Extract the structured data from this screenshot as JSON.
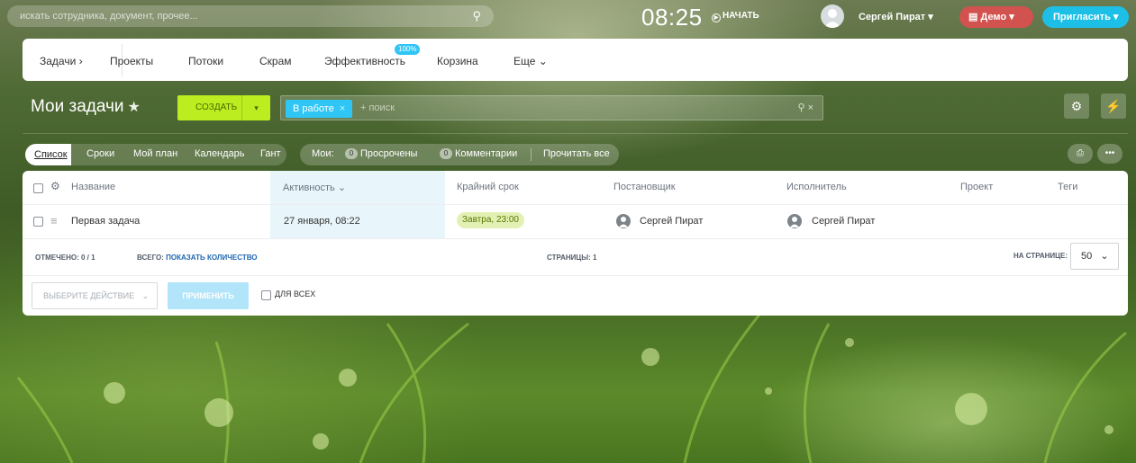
{
  "topbar": {
    "search_placeholder": "искать сотрудника, документ, прочее...",
    "clock": "08:25",
    "start_label": "НАЧАТЬ",
    "user_name": "Сергей Пират",
    "demo_label": "Демо",
    "invite_label": "Пригласить"
  },
  "nav": {
    "items": [
      "Задачи",
      "Проекты",
      "Потоки",
      "Скрам",
      "Эффективность",
      "Корзина",
      "Еще"
    ],
    "efficiency_badge": "100%"
  },
  "header": {
    "title": "Мои задачи",
    "create_label": "СОЗДАТЬ",
    "filter_chip": "В работе",
    "filter_placeholder": "+ поиск"
  },
  "views": {
    "items": [
      "Список",
      "Сроки",
      "Мой план",
      "Календарь",
      "Гант"
    ],
    "active": "Список"
  },
  "counters": {
    "label": "Мои:",
    "overdue_count": "0",
    "overdue_label": "Просрочены",
    "comments_count": "0",
    "comments_label": "Комментарии",
    "read_all": "Прочитать все"
  },
  "table": {
    "columns": [
      "Название",
      "Активность",
      "Крайний срок",
      "Постановщик",
      "Исполнитель",
      "Проект",
      "Теги"
    ],
    "rows": [
      {
        "title": "Первая задача",
        "activity": "27 января, 08:22",
        "deadline": "Завтра, 23:00",
        "creator": "Сергей Пират",
        "responsible": "Сергей Пират",
        "project": "",
        "tags": ""
      }
    ]
  },
  "footer": {
    "marked_label": "ОТМЕЧЕНО:",
    "marked_value": "0 / 1",
    "total_label": "ВСЕГО:",
    "total_link": "ПОКАЗАТЬ КОЛИЧЕСТВО",
    "pages_label": "СТРАНИЦЫ:",
    "pages_value": "1",
    "per_page_label": "НА СТРАНИЦЕ:",
    "per_page_value": "50",
    "action_placeholder": "ВЫБЕРИТЕ ДЕЙСТВИЕ",
    "apply_label": "ПРИМЕНИТЬ",
    "for_all_label": "ДЛЯ ВСЕХ"
  },
  "colors": {
    "accent_blue": "#2fc6f6",
    "create_green": "#bbed21",
    "demo_red": "#d1524e",
    "invite_blue": "#1ebfe6",
    "deadline_bg": "#e2f1b3"
  },
  "icons": [
    "search-icon",
    "play-icon",
    "user-avatar",
    "chevron-down-icon",
    "star-icon",
    "close-icon",
    "gear-icon",
    "lightning-icon",
    "print-icon",
    "more-icon",
    "menu-icon"
  ]
}
